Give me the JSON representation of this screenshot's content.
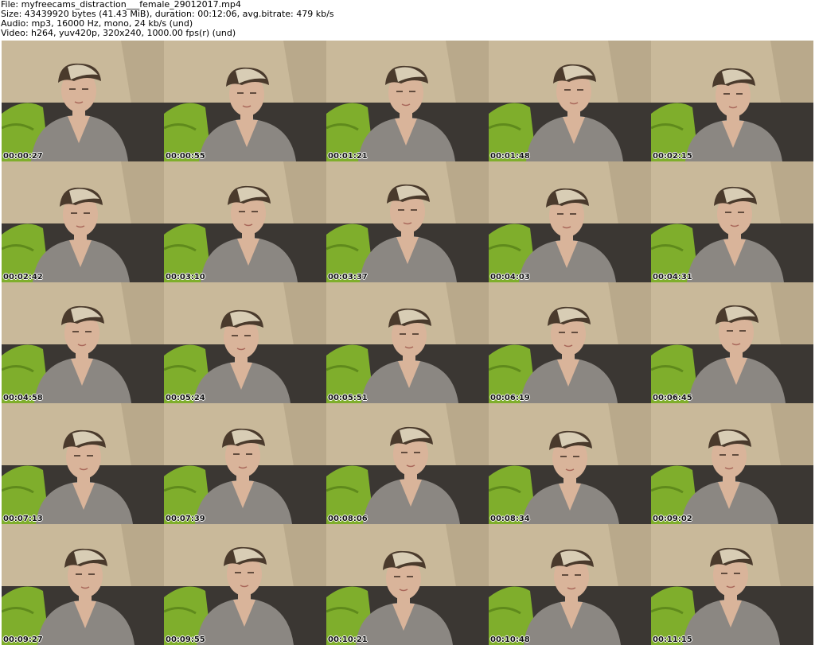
{
  "header": {
    "file": "File: myfreecams_distraction___female_29012017.mp4",
    "size": "Size: 43439920 bytes (41.43 MiB), duration: 00:12:06, avg.bitrate: 479 kb/s",
    "audio": "Audio: mp3, 16000 Hz, mono, 24 kb/s (und)",
    "video": "Video: h264, yuv420p, 320x240, 1000.00 fps(r) (und)"
  },
  "thumbnails": [
    {
      "timestamp": "00:00:27"
    },
    {
      "timestamp": "00:00:55"
    },
    {
      "timestamp": "00:01:21"
    },
    {
      "timestamp": "00:01:48"
    },
    {
      "timestamp": "00:02:15"
    },
    {
      "timestamp": "00:02:42"
    },
    {
      "timestamp": "00:03:10"
    },
    {
      "timestamp": "00:03:37"
    },
    {
      "timestamp": "00:04:03"
    },
    {
      "timestamp": "00:04:31"
    },
    {
      "timestamp": "00:04:58"
    },
    {
      "timestamp": "00:05:24"
    },
    {
      "timestamp": "00:05:51"
    },
    {
      "timestamp": "00:06:19"
    },
    {
      "timestamp": "00:06:45"
    },
    {
      "timestamp": "00:07:13"
    },
    {
      "timestamp": "00:07:39"
    },
    {
      "timestamp": "00:08:06"
    },
    {
      "timestamp": "00:08:34"
    },
    {
      "timestamp": "00:09:02"
    },
    {
      "timestamp": "00:09:27"
    },
    {
      "timestamp": "00:09:55"
    },
    {
      "timestamp": "00:10:21"
    },
    {
      "timestamp": "00:10:48"
    },
    {
      "timestamp": "00:11:15"
    }
  ],
  "colors": {
    "wall": "#c9b99a",
    "sofa": "#3b3733",
    "pillow": "#7fae2c",
    "robe": "#8b8782",
    "skin": "#d9b49a",
    "hair_dark": "#4a3a2c",
    "hair_light": "#d8cdb5"
  }
}
